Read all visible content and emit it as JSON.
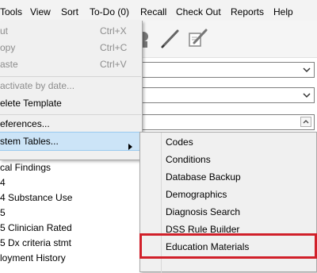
{
  "menubar": {
    "items": [
      "Tools",
      "View",
      "Sort",
      "To-Do (0)",
      "Recall",
      "Check Out",
      "Reports",
      "Help"
    ]
  },
  "edit_menu": {
    "cut": {
      "label": "ut",
      "shortcut": "Ctrl+X"
    },
    "copy": {
      "label": "opy",
      "shortcut": "Ctrl+C"
    },
    "paste": {
      "label": "aste",
      "shortcut": "Ctrl+V"
    },
    "inactivate": {
      "label": "activate by date..."
    },
    "delete_template": {
      "label": "elete Template"
    },
    "preferences": {
      "label": "eferences..."
    },
    "system_tables": {
      "label": "stem Tables..."
    }
  },
  "list": {
    "items": [
      "cal Findings",
      "4",
      "4 Substance Use",
      "5",
      "5 Clinician Rated",
      "5 Dx criteria stmt",
      "loyment History"
    ]
  },
  "submenu": {
    "items": [
      "Codes",
      "Conditions",
      "Database Backup",
      "Demographics",
      "Diagnosis Search",
      "DSS Rule Builder",
      "Education Materials"
    ],
    "highlighted": "Education Materials",
    "highlight_color": "#d1202a"
  },
  "icons": [
    "pen-icon",
    "edit-pen-icon"
  ]
}
